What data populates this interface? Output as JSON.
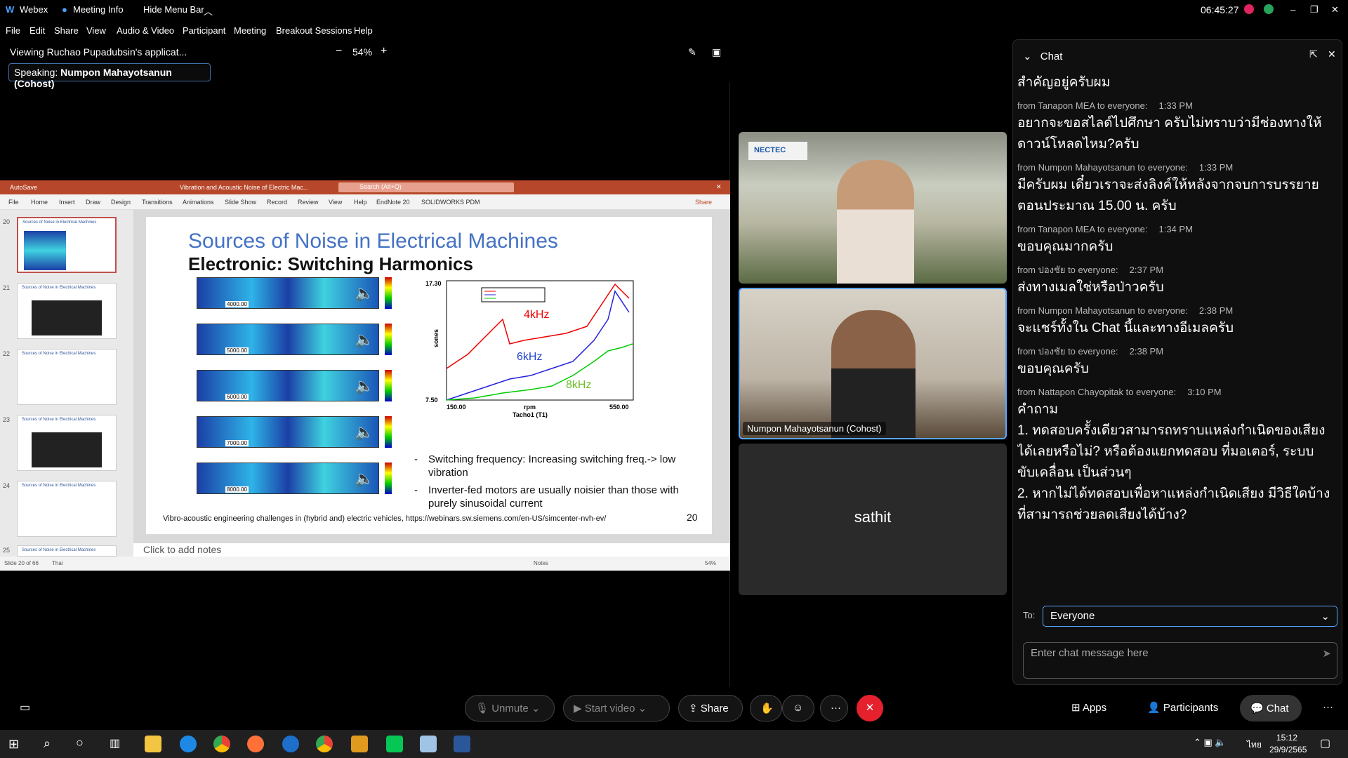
{
  "titlebar": {
    "app": "Webex",
    "meeting_info": "Meeting Info",
    "hide_menu": "Hide Menu Bar",
    "time": "06:45:27"
  },
  "menubar": {
    "items": [
      "File",
      "Edit",
      "Share",
      "View",
      "Audio & Video",
      "Participant",
      "Meeting",
      "Breakout Sessions",
      "Help"
    ]
  },
  "viewing": {
    "text": "Viewing Ruchao Pupadubsin's applicat...",
    "zoom": "54%",
    "speaking_label": "Speaking:",
    "speaking_name": "Numpon Mahayotsanun (Cohost)"
  },
  "ppt": {
    "autosave": "AutoSave",
    "doc_title": "Vibration and Acoustic Noise of Electric Mac...",
    "search": "Search (Alt+Q)",
    "tabs": [
      "File",
      "Home",
      "Insert",
      "Draw",
      "Design",
      "Transitions",
      "Animations",
      "Slide Show",
      "Record",
      "Review",
      "View",
      "Help",
      "EndNote 20",
      "SOLIDWORKS PDM"
    ],
    "share": "Share",
    "thumb_title": "Sources of Noise in Electrical Machines",
    "thumb_nums": [
      "20",
      "21",
      "22",
      "23",
      "24",
      "25"
    ],
    "slide_title": "Sources of Noise in Electrical Machines",
    "slide_subtitle": "Electronic: Switching Harmonics",
    "spectra": [
      "4000.00",
      "5000.00",
      "6000.00",
      "7000.00",
      "8000.00"
    ],
    "graph_labels": {
      "y_top": "17.30",
      "y_bottom": "7.50",
      "x_left": "150.00",
      "x_right": "550.00",
      "xlabel": "rpm",
      "xsub": "Tacho1 (T1)",
      "ylabel": "sones",
      "l4": "4kHz",
      "l6": "6kHz",
      "l8": "8kHz"
    },
    "bullets": [
      "Switching frequency: Increasing switching freq.-> low vibration",
      "Inverter-fed motors are usually noisier than those with purely sinusoidal current"
    ],
    "footer": "Vibro-acoustic engineering challenges in (hybrid and) electric vehicles, https://webinars.sw.siemens.com/en-US/simcenter-nvh-ev/",
    "slide_number": "20",
    "notes": "Click to add notes",
    "status_left": "Slide 20 of 66",
    "status_lang": "Thai",
    "status_notes": "Notes",
    "status_zoom": "54%"
  },
  "videos": {
    "v2_name": "Numpon Mahayotsanun (Cohost)",
    "v3_name": "sathit",
    "v1_logo": "NECTEC"
  },
  "chat": {
    "title": "Chat",
    "messages": [
      {
        "from": "",
        "time": "",
        "text": "สำคัญอยู่ครับผม"
      },
      {
        "from": "from Tanapon MEA to everyone:",
        "time": "1:33 PM",
        "text": "อยากจะขอสไลด์ไปศึกษา ครับไม่ทราบว่ามีช่องทางให้ดาวน์โหลดไหม?ครับ"
      },
      {
        "from": "from Numpon Mahayotsanun to everyone:",
        "time": "1:33 PM",
        "text": "มีครับผม เดี๋ยวเราจะส่งลิงค์ให้หลังจากจบการบรรยายตอนประมาณ 15.00 น. ครับ"
      },
      {
        "from": "from Tanapon MEA to everyone:",
        "time": "1:34 PM",
        "text": "ขอบคุณมากครับ"
      },
      {
        "from": "from ปองชัย to everyone:",
        "time": "2:37 PM",
        "text": "ส่งทางเมลใช่หรือป่าวครับ"
      },
      {
        "from": "from Numpon Mahayotsanun to everyone:",
        "time": "2:38 PM",
        "text": "จะแชร์ทั้งใน Chat นี้และทางอีเมลครับ"
      },
      {
        "from": "from ปองชัย to everyone:",
        "time": "2:38 PM",
        "text": "ขอบคุณครับ"
      },
      {
        "from": "from Nattapon Chayopitak to everyone:",
        "time": "3:10 PM",
        "text": "คำถาม\n1. ทดสอบครั้งเดียวสามารถทราบแหล่งกำเนิดของเสียงได้เลยหรือไม่? หรือต้องแยกทดสอบ ที่มอเตอร์, ระบบขับเคลื่อน เป็นส่วนๆ\n2. หากไม่ได้ทดสอบเพื่อหาแหล่งกำเนิดเสียง มีวิธีใดบ้างที่สามารถช่วยลดเสียงได้บ้าง?"
      }
    ],
    "to_label": "To:",
    "to_value": "Everyone",
    "input_placeholder": "Enter chat message here"
  },
  "controls": {
    "unmute": "Unmute",
    "start_video": "Start video",
    "share": "Share",
    "apps": "Apps",
    "participants": "Participants",
    "chat": "Chat"
  },
  "taskbar": {
    "lang": "ไทย",
    "time": "15:12",
    "date": "29/9/2565"
  }
}
